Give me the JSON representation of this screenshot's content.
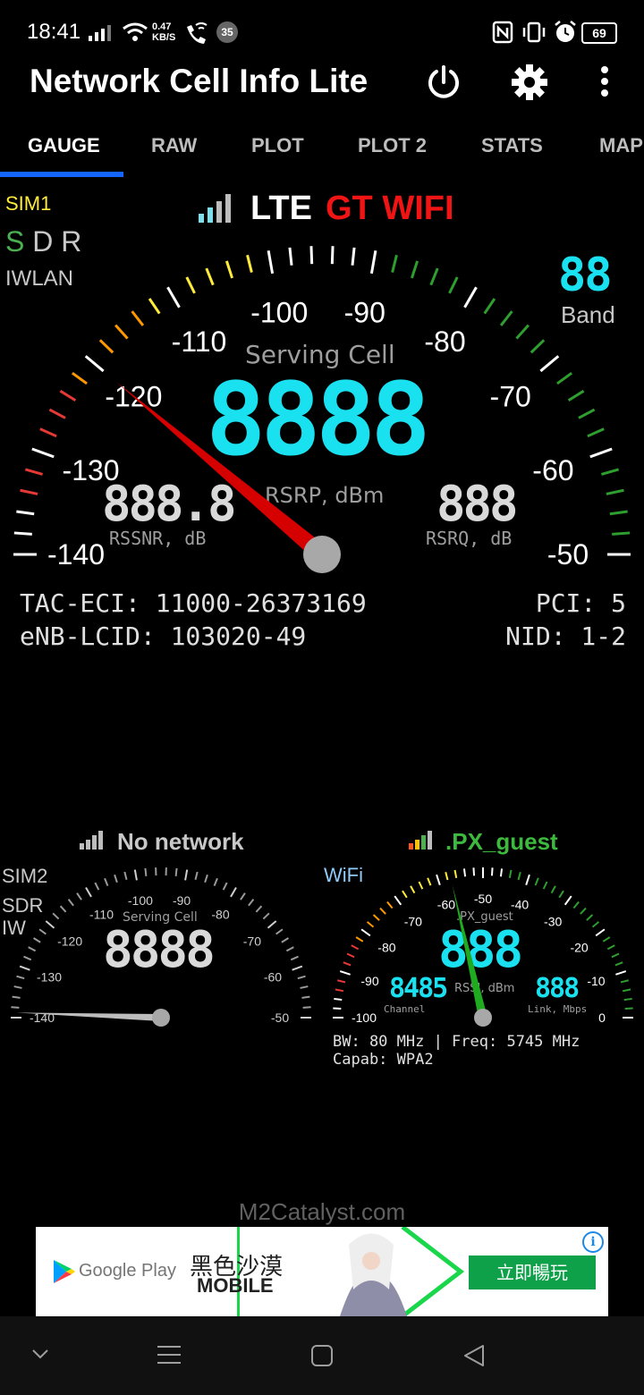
{
  "status": {
    "time": "18:41",
    "net_speed_value": "0.47",
    "net_speed_unit": "KB/S",
    "badge": "35",
    "battery": "69"
  },
  "app": {
    "title": "Network Cell Info Lite"
  },
  "tabs": [
    {
      "label": "GAUGE",
      "active": true
    },
    {
      "label": "RAW"
    },
    {
      "label": "PLOT"
    },
    {
      "label": "PLOT 2"
    },
    {
      "label": "STATS"
    },
    {
      "label": "MAP"
    }
  ],
  "main_gauge": {
    "sim_label": "SIM1",
    "sdr_s": "S",
    "sdr_rest": "D R",
    "iwlan": "IWLAN",
    "tech": "LTE",
    "operator": "GT WIFI",
    "band_digits": "88",
    "band_label": "Band",
    "center_label": "Serving Cell",
    "rsrp_digits": "8888",
    "rsrp_label": "RSRP, dBm",
    "rssnr_digits": "888.8",
    "rssnr_label": "RSSNR, dB",
    "rsrq_digits": "888",
    "rsrq_label": "RSRQ, dB",
    "scale_labels": [
      "-140",
      "-130",
      "-120",
      "-110",
      "-100",
      "-90",
      "-80",
      "-70",
      "-60",
      "-50"
    ],
    "needle_value": -120
  },
  "cell_info": {
    "tac_eci": "TAC-ECI: 11000-26373169",
    "enb_lcid": "eNB-LCID: 103020-49",
    "pci": "PCI: 5",
    "nid": "NID: 1-2"
  },
  "sim2_gauge": {
    "title": "No network",
    "sim_label": "SIM2",
    "sdr": "SDR",
    "iw": "IW",
    "center_label": "Serving Cell",
    "digits": "8888",
    "scale_labels": [
      "-140",
      "-130",
      "-120",
      "-110",
      "-100",
      "-90",
      "-80",
      "-70",
      "-60",
      "-50"
    ]
  },
  "wifi_gauge": {
    "ssid": ".PX_guest",
    "wifi_label": "WiFi",
    "center_label": ".PX_guest",
    "digits": "888",
    "rssi_label": "RSSI, dBm",
    "channel_digits": "8485",
    "channel_label": "Channel",
    "link_digits": "888",
    "link_label": "Link, Mbps",
    "scale_labels": [
      "-100",
      "-90",
      "-80",
      "-70",
      "-60",
      "-50",
      "-40",
      "-30",
      "-20",
      "-10",
      "0"
    ],
    "bw_freq": "BW: 80 MHz | Freq: 5745 MHz",
    "capab": "Capab: WPA2"
  },
  "footer": {
    "brand": "M2Catalyst.com"
  },
  "ad": {
    "store": "Google Play",
    "game_title_cn": "黑色沙漠",
    "game_subtitle": "MOBILE",
    "cta": "立即暢玩",
    "info": "i"
  }
}
